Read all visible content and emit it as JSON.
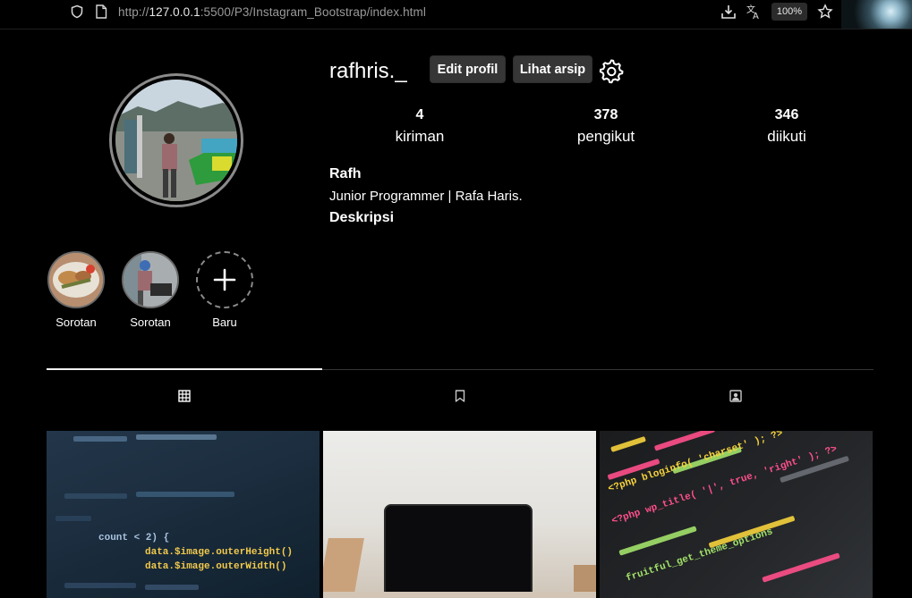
{
  "browser": {
    "url_prefix": "http://",
    "url_host": "127.0.0.1",
    "url_rest": ":5500/P3/Instagram_Bootstrap/index.html",
    "zoom": "100%",
    "icons": [
      "shield-icon",
      "page-icon",
      "download-icon",
      "translate-icon",
      "star-icon"
    ]
  },
  "profile": {
    "username": "rafhris._",
    "edit_button": "Edit profil",
    "archive_button": "Lihat arsip",
    "stats": [
      {
        "value": "4",
        "label": "kiriman"
      },
      {
        "value": "378",
        "label": "pengikut"
      },
      {
        "value": "346",
        "label": "diikuti"
      }
    ],
    "name": "Rafh",
    "bio": "Junior Programmer | Rafa Haris.",
    "description": "Deskripsi"
  },
  "highlights": [
    {
      "label": "Sorotan"
    },
    {
      "label": "Sorotan"
    },
    {
      "label": "Baru"
    }
  ],
  "tabs": [
    "grid-icon",
    "bookmark-icon",
    "tagged-icon"
  ],
  "posts": {
    "p1": {
      "code_a": "count < 2) {",
      "code_b": "data.$image.outerHeight()",
      "code_c": "data.$image.outerWidth()"
    },
    "p3": {
      "code_a": "<?php bloginfo( 'charset' ); ?>",
      "code_b": "<?php wp_title( '|', true, 'right' ); ?>",
      "code_c": "fruitful_get_theme_options"
    }
  },
  "colors": {
    "background": "#000000",
    "button": "#363636",
    "accent_code_yellow": "#f7d33c",
    "accent_code_pink": "#ff4f8b"
  }
}
